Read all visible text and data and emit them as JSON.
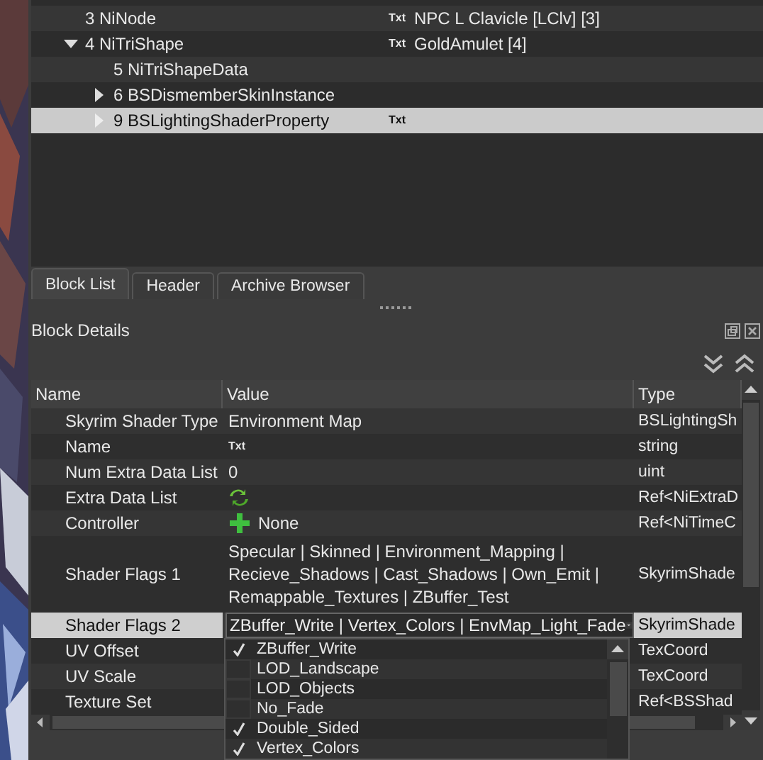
{
  "tree": {
    "rows": [
      {
        "label": "3 NiNode",
        "icon_text": "Txt",
        "value": "NPC L Clavicle [LClv] [3]",
        "selected": false
      },
      {
        "label": "4 NiTriShape",
        "icon_text": "Txt",
        "value": "GoldAmulet [4]",
        "expanded": true,
        "selected": false,
        "children": [
          {
            "label": "5 NiTriShapeData",
            "selected": false
          },
          {
            "label": "6 BSDismemberSkinInstance",
            "expanded": false,
            "selected": false
          },
          {
            "label": "9 BSLightingShaderProperty",
            "icon_text": "Txt",
            "expanded": false,
            "selected": true
          }
        ]
      }
    ]
  },
  "tabs": [
    {
      "label": "Block List",
      "selected": true
    },
    {
      "label": "Header",
      "selected": false
    },
    {
      "label": "Archive Browser",
      "selected": false
    }
  ],
  "details": {
    "title": "Block Details",
    "columns": [
      "Name",
      "Value",
      "Type"
    ],
    "rows": [
      {
        "name": "Skyrim Shader Type",
        "value": "Environment Map",
        "type": "BSLightingSh",
        "selected": false
      },
      {
        "name": "Name",
        "icon_text": "Txt",
        "type": "string",
        "selected": false
      },
      {
        "name": "Num Extra Data List",
        "value": "0",
        "type": "uint",
        "selected": false
      },
      {
        "name": "Extra Data List",
        "kind": "refresh",
        "type": "Ref<NiExtraD",
        "selected": false
      },
      {
        "name": "Controller",
        "kind": "add",
        "value": "None",
        "type": "Ref<NiTimeC",
        "selected": false
      },
      {
        "name": "Shader Flags 1",
        "value": "Specular | Skinned | Environment_Mapping | Recieve_Shadows | Cast_Shadows | Own_Emit | Remappable_Textures | ZBuffer_Test",
        "type": "SkyrimShade",
        "selected": false
      },
      {
        "name": "Shader Flags 2",
        "value": "ZBuffer_Write | Vertex_Colors | EnvMap_Light_Fade",
        "type": "SkyrimShade",
        "selected": true,
        "editor": {
          "options": [
            {
              "label": "ZBuffer_Write",
              "checked": true
            },
            {
              "label": "LOD_Landscape",
              "checked": false
            },
            {
              "label": "LOD_Objects",
              "checked": false
            },
            {
              "label": "No_Fade",
              "checked": false
            },
            {
              "label": "Double_Sided",
              "checked": true
            },
            {
              "label": "Vertex_Colors",
              "checked": true
            }
          ]
        }
      },
      {
        "name": "UV Offset",
        "type": "TexCoord",
        "selected": false
      },
      {
        "name": "UV Scale",
        "type": "TexCoord",
        "selected": false
      },
      {
        "name": "Texture Set",
        "type": "Ref<BSShad",
        "selected": false
      }
    ]
  }
}
